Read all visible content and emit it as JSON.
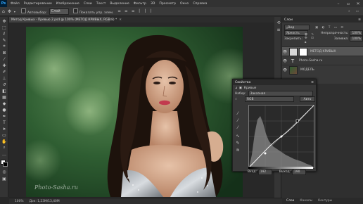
{
  "menu": {
    "items": [
      "Файл",
      "Редактирование",
      "Изображение",
      "Слои",
      "Текст",
      "Выделение",
      "Фильтр",
      "3D",
      "Просмотр",
      "Окно",
      "Справка"
    ]
  },
  "options": {
    "autoselect": "Автовыбор:",
    "layer_select": "Слой",
    "transform": "Показать упр. элем."
  },
  "document": {
    "tab_title": "Метод Кривых - Превью 2.psd @ 100% (МЕТОД КРИВЫХ, RGB/8) *",
    "watermark": "Photo-Sasha.ru"
  },
  "status": {
    "zoom": "100%",
    "doc_info": "Док: 1,23M/13,40M"
  },
  "layers_panel": {
    "title": "Слои",
    "search": "Вид",
    "blend_mode": "Яркость",
    "opacity_label": "Непрозрачность:",
    "opacity_value": "100%",
    "lock_label": "Закрепить:",
    "fill_label": "Заливка:",
    "fill_value": "100%",
    "layers": [
      {
        "name": "МЕТОД КРИВЫХ"
      },
      {
        "name": "Photo-Sasha.ru"
      },
      {
        "name": "МОДЕЛЬ"
      }
    ]
  },
  "properties_panel": {
    "title": "Свойства",
    "sub_title": "Кривые",
    "preset_label": "Набор:",
    "preset_value": "Заказная",
    "channel_value": "RGB",
    "auto_label": "Авто",
    "input_label": "Вход:",
    "input_value": "192",
    "output_label": "Выход:",
    "output_value": "190"
  },
  "bottom_tabs": [
    "Слои",
    "Каналы",
    "Контуры"
  ],
  "colors": {
    "ps_blue": "#31a8ff",
    "panel_bg": "#383838",
    "canvas_bg": "#282828"
  }
}
